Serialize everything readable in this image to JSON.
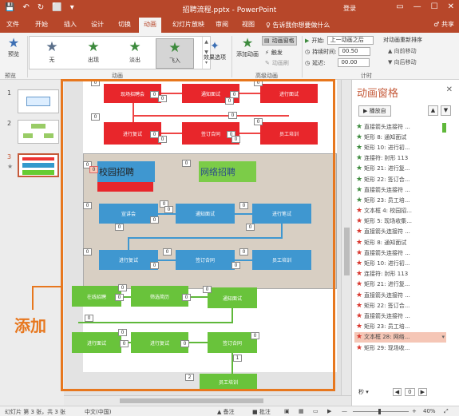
{
  "titlebar": {
    "quick_access": [
      "💾",
      "↶",
      "↻",
      "⬜",
      "▾"
    ],
    "title": "招聘流程.pptx  -  PowerPoint",
    "login": "登录",
    "controls": [
      "▭",
      "—",
      "☐",
      "✕"
    ]
  },
  "tabs": {
    "items": [
      "文件",
      "开始",
      "插入",
      "设计",
      "切换",
      "动画",
      "幻灯片放映",
      "审阅",
      "视图"
    ],
    "active": "动画",
    "tell_me": "♀ 告诉我你想要做什么",
    "share": "♂ 共享"
  },
  "ribbon": {
    "preview_label": "预览",
    "preview_group": "预览",
    "effects": [
      {
        "label": "无",
        "kind": "none"
      },
      {
        "label": "出现",
        "kind": "green"
      },
      {
        "label": "淡出",
        "kind": "green"
      },
      {
        "label": "飞入",
        "kind": "green"
      }
    ],
    "animation_group": "动画",
    "effect_options": "效果选项",
    "add_animation": "添加动画",
    "anim_pane_btn": "动画窗格",
    "trigger_btn": "触发",
    "anim_painter": "动画刷",
    "advanced_group": "高级动画",
    "start_label": "开始:",
    "start_value": "上一动画之后",
    "duration_label": "持续时间:",
    "duration_value": "00.50",
    "delay_label": "延迟:",
    "delay_value": "00.00",
    "reorder_label": "对动画重新排序",
    "move_earlier": "▲ 向前移动",
    "move_later": "▼ 向后移动",
    "timing_group": "计时"
  },
  "thumbs": {
    "numbers": [
      "1",
      "2",
      "3"
    ],
    "active_index": 3,
    "star": "★"
  },
  "slide": {
    "top_row": [
      "现场招聘会",
      "通知面试",
      "进行面试"
    ],
    "mid_row": [
      "进行复试",
      "签订合同",
      "员工培训"
    ],
    "group1_left": "校园招聘",
    "group1_right": "网络招聘",
    "blue_row1": [
      "宣讲会",
      "通知面试",
      "进行笔试"
    ],
    "blue_row2": [
      "进行复试",
      "签订合同",
      "员工培训"
    ],
    "green_row1": [
      "在线招聘",
      "筛选简历",
      "通知面试"
    ],
    "green_row2": [
      "进行面试",
      "进行复试",
      "签订合同"
    ],
    "green_bottom": "员工培训",
    "tags_zero": "0",
    "tag_one": "1",
    "tag_two": "2"
  },
  "annotation": "添加",
  "pane": {
    "title": "动画窗格",
    "close": "✕",
    "play_label": "▶ 播放自",
    "up": "▲",
    "down": "▼",
    "items": [
      {
        "text": "直接箭头连接符 ...",
        "kind": "green"
      },
      {
        "text": "矩形 8: 通知面试",
        "kind": "green"
      },
      {
        "text": "矩形 10: 进行初...",
        "kind": "green"
      },
      {
        "text": "连接符: 肘形 113",
        "kind": "green"
      },
      {
        "text": "矩形 21: 进行复...",
        "kind": "green"
      },
      {
        "text": "矩形 22: 签订合...",
        "kind": "green"
      },
      {
        "text": "直接箭头连接符 ...",
        "kind": "green"
      },
      {
        "text": "矩形 23: 员工培...",
        "kind": "green"
      },
      {
        "text": "文本框 4: 校园招...",
        "kind": "red"
      },
      {
        "text": "矩形 5: 现场收集...",
        "kind": "red"
      },
      {
        "text": "直接箭头连接符 ...",
        "kind": "red"
      },
      {
        "text": "矩形 8: 通知面试",
        "kind": "red"
      },
      {
        "text": "直接箭头连接符 ...",
        "kind": "red"
      },
      {
        "text": "矩形 10: 进行初...",
        "kind": "red"
      },
      {
        "text": "连接符: 肘形 113",
        "kind": "red"
      },
      {
        "text": "矩形 21: 进行复...",
        "kind": "red"
      },
      {
        "text": "直接箭头连接符 ...",
        "kind": "red"
      },
      {
        "text": "矩形 22: 签订合...",
        "kind": "red"
      },
      {
        "text": "直接箭头连接符 ...",
        "kind": "red"
      },
      {
        "text": "矩形 23: 员工培...",
        "kind": "red"
      },
      {
        "text": "文本框 28: 网络...",
        "kind": "red",
        "highlight": true
      },
      {
        "text": "矩形 29: 现场收...",
        "kind": "red"
      }
    ],
    "seconds_label": "秒 ▾",
    "nav_left": "◀",
    "nav_zero": "0",
    "nav_right": "▶"
  },
  "status": {
    "slide_info": "幻灯片 第 3 张，共 3 张",
    "language": "中文(中国)",
    "notes": "▲ 备注",
    "comments": "■ 批注",
    "zoom": "40%",
    "minus": "—",
    "plus": "+"
  }
}
